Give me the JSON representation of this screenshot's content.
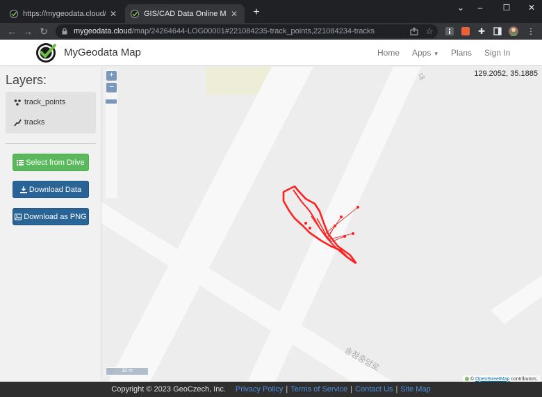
{
  "browser": {
    "tabs": [
      {
        "title": "https://mygeodata.cloud/conve",
        "favicon": "mygeodata-logo-icon"
      },
      {
        "title": "GIS/CAD Data Online Map View",
        "favicon": "mygeodata-logo-icon"
      }
    ],
    "url_host": "mygeodata.cloud",
    "url_path": "/map/24264644-LOG00001#221084235-track_points,221084234-tracks",
    "new_tab_symbol": "+",
    "window_controls": {
      "minimize": "–",
      "maximize": "☐",
      "close": "✕"
    }
  },
  "site": {
    "brand": "MyGeodata Map",
    "nav": {
      "home": "Home",
      "apps": "Apps",
      "plans": "Plans",
      "signin": "Sign In"
    }
  },
  "sidebar": {
    "layers_title": "Layers:",
    "layers": [
      {
        "name": "track_points",
        "icon": "points-icon"
      },
      {
        "name": "tracks",
        "icon": "line-icon"
      }
    ],
    "buttons": {
      "select_drive": "Select from Drive",
      "download_data": "Download Data",
      "download_png": "Download as PNG"
    }
  },
  "map": {
    "zoom_in": "+",
    "zoom_out": "−",
    "coordinates": "129.2052, 35.1885",
    "scale": "10 m",
    "attribution_prefix": "©",
    "attribution_link": "OpenStreetMap",
    "attribution_suffix": "contributors.",
    "track_color": "#ff2020"
  },
  "footer": {
    "copyright": "Copyright © 2023 GeoCzech, Inc.",
    "links": [
      "Privacy Policy",
      "Terms of Service",
      "Contact Us",
      "Site Map"
    ]
  }
}
